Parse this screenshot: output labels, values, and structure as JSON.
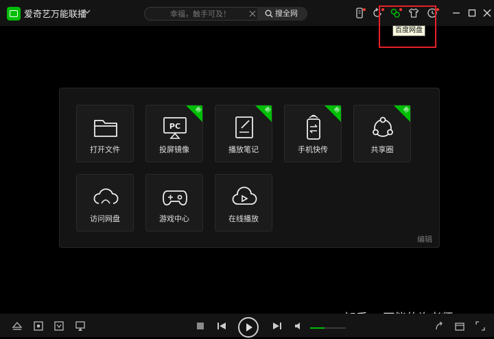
{
  "app": {
    "title": "爱奇艺万能联播"
  },
  "search": {
    "placeholder": "幸福，触手可及！",
    "button_label": "搜全网"
  },
  "tooltip": {
    "text": "百度网盘"
  },
  "toolbar_icons": [
    "phone-screen-icon",
    "refresh-icon",
    "baidu-pan-icon",
    "skin-tshirt-icon",
    "history-clock-icon"
  ],
  "window_controls": [
    "minimize-icon",
    "maximize-icon",
    "close-icon"
  ],
  "panel": {
    "edit_label": "编辑",
    "new_badge": "新",
    "items": [
      {
        "label": "打开文件",
        "icon": "folder-icon",
        "is_new": false
      },
      {
        "label": "投屏镜像",
        "icon": "pc-cast-icon",
        "is_new": true
      },
      {
        "label": "播放笔记",
        "icon": "note-edit-icon",
        "is_new": true
      },
      {
        "label": "手机快传",
        "icon": "phone-transfer-icon",
        "is_new": true
      },
      {
        "label": "共享圈",
        "icon": "share-circle-icon",
        "is_new": true
      },
      {
        "label": "访问网盘",
        "icon": "cloud-icon",
        "is_new": false
      },
      {
        "label": "游戏中心",
        "icon": "gamepad-icon",
        "is_new": false
      },
      {
        "label": "在线播放",
        "icon": "cloud-play-icon",
        "is_new": false
      }
    ]
  },
  "watermark": {
    "text": "知乎 @万能的许老师"
  },
  "player": {
    "volume_level": 0.4
  },
  "colors": {
    "accent": "#00be06",
    "highlight": "#e8202a",
    "background": "#000000"
  }
}
